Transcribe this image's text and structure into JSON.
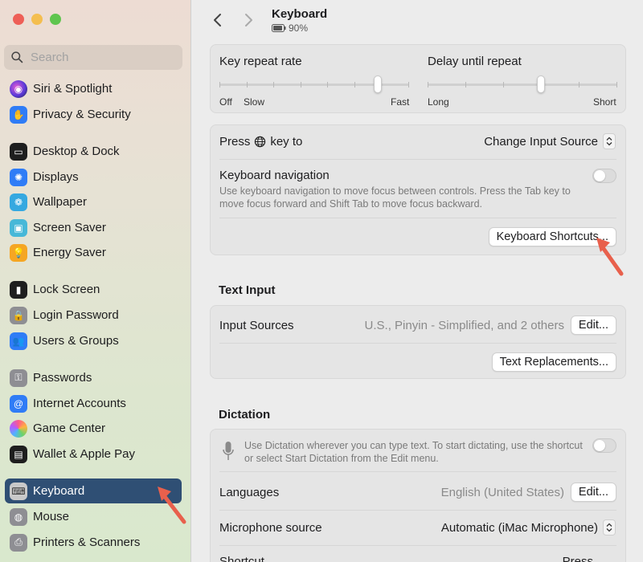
{
  "sidebar": {
    "search_placeholder": "Search",
    "items": [
      {
        "label": "Siri & Spotlight",
        "icon": "siri-icon"
      },
      {
        "label": "Privacy & Security",
        "icon": "hand-icon"
      },
      {
        "label": "Desktop & Dock",
        "icon": "dock-icon"
      },
      {
        "label": "Displays",
        "icon": "sun-icon"
      },
      {
        "label": "Wallpaper",
        "icon": "flower-icon"
      },
      {
        "label": "Screen Saver",
        "icon": "screensaver-icon"
      },
      {
        "label": "Energy Saver",
        "icon": "bulb-icon"
      },
      {
        "label": "Lock Screen",
        "icon": "lock-icon"
      },
      {
        "label": "Login Password",
        "icon": "padlock-icon"
      },
      {
        "label": "Users & Groups",
        "icon": "users-icon"
      },
      {
        "label": "Passwords",
        "icon": "key-icon"
      },
      {
        "label": "Internet Accounts",
        "icon": "at-icon"
      },
      {
        "label": "Game Center",
        "icon": "game-center-icon"
      },
      {
        "label": "Wallet & Apple Pay",
        "icon": "wallet-icon"
      },
      {
        "label": "Keyboard",
        "icon": "keyboard-icon"
      },
      {
        "label": "Mouse",
        "icon": "mouse-icon"
      },
      {
        "label": "Printers & Scanners",
        "icon": "printer-icon"
      }
    ],
    "selected": "Keyboard"
  },
  "header": {
    "title": "Keyboard",
    "battery": "90%"
  },
  "repeat": {
    "key_repeat_label": "Key repeat rate",
    "key_repeat_min": "Off",
    "key_repeat_slow": "Slow",
    "key_repeat_max": "Fast",
    "key_repeat_level": 0.85,
    "delay_label": "Delay until repeat",
    "delay_min": "Long",
    "delay_max": "Short",
    "delay_level": 0.6
  },
  "keyboard": {
    "press_key_prefix": "Press",
    "press_key_suffix": "key to",
    "press_key_value": "Change Input Source",
    "nav_label": "Keyboard navigation",
    "nav_desc": "Use keyboard navigation to move focus between controls. Press the Tab key to move focus forward and Shift Tab to move focus backward.",
    "shortcuts_button": "Keyboard Shortcuts..."
  },
  "text_input": {
    "heading": "Text Input",
    "sources_label": "Input Sources",
    "sources_value": "U.S., Pinyin - Simplified, and 2 others",
    "edit_button": "Edit...",
    "replacements_button": "Text Replacements..."
  },
  "dictation": {
    "heading": "Dictation",
    "desc": "Use Dictation wherever you can type text. To start dictating, use the shortcut or select Start Dictation from the Edit menu.",
    "languages_label": "Languages",
    "languages_value": "English (United States)",
    "edit_button": "Edit...",
    "mic_label": "Microphone source",
    "mic_value": "Automatic (iMac Microphone)",
    "shortcut_label": "Shortcut",
    "shortcut_value": "Press"
  },
  "colors": {
    "selected_bg": "#2f4f74",
    "annotation_arrow": "#e8604c"
  }
}
